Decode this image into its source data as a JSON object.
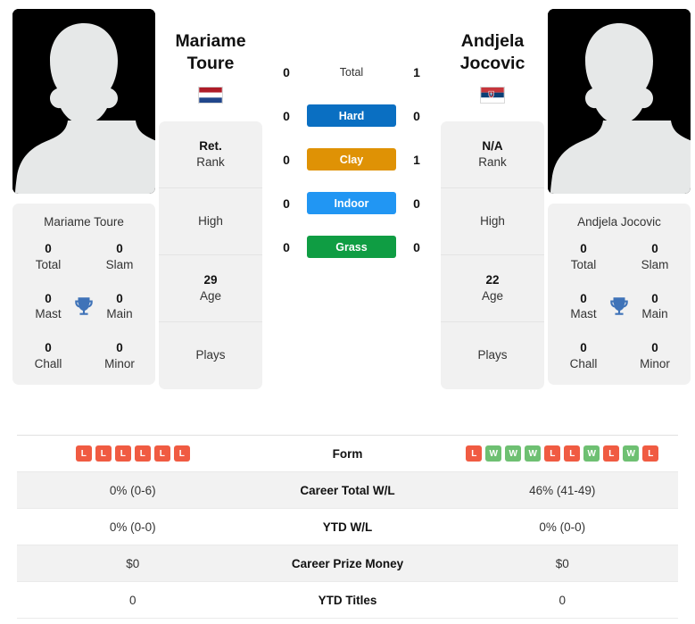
{
  "players": {
    "left": {
      "name_line1": "Mariame",
      "name_line2": "Toure",
      "full_name": "Mariame Toure",
      "flag": "netherlands-flag",
      "rank_value": "Ret.",
      "rank_label": "Rank",
      "high_label": "High",
      "age_value": "29",
      "age_label": "Age",
      "plays_label": "Plays",
      "titles": [
        {
          "num": "0",
          "label": "Total"
        },
        {
          "num": "0",
          "label": "Slam"
        },
        {
          "num": "0",
          "label": "Mast"
        },
        {
          "num": "0",
          "label": "Main"
        },
        {
          "num": "0",
          "label": "Chall"
        },
        {
          "num": "0",
          "label": "Minor"
        }
      ],
      "form": [
        "L",
        "L",
        "L",
        "L",
        "L",
        "L"
      ],
      "career_total_wl": "0% (0-6)",
      "ytd_wl": "0% (0-0)",
      "career_prize_money": "$0",
      "ytd_titles": "0"
    },
    "right": {
      "name_line1": "Andjela",
      "name_line2": "Jocovic",
      "full_name": "Andjela Jocovic",
      "flag": "serbia-flag",
      "rank_value": "N/A",
      "rank_label": "Rank",
      "high_label": "High",
      "age_value": "22",
      "age_label": "Age",
      "plays_label": "Plays",
      "titles": [
        {
          "num": "0",
          "label": "Total"
        },
        {
          "num": "0",
          "label": "Slam"
        },
        {
          "num": "0",
          "label": "Mast"
        },
        {
          "num": "0",
          "label": "Main"
        },
        {
          "num": "0",
          "label": "Chall"
        },
        {
          "num": "0",
          "label": "Minor"
        }
      ],
      "form": [
        "L",
        "W",
        "W",
        "W",
        "L",
        "L",
        "W",
        "L",
        "W",
        "L"
      ],
      "career_total_wl": "46% (41-49)",
      "ytd_wl": "0% (0-0)",
      "career_prize_money": "$0",
      "ytd_titles": "0"
    }
  },
  "h2h": [
    {
      "label": "Total",
      "left": "0",
      "right": "1",
      "color": "transparent",
      "plain": true
    },
    {
      "label": "Hard",
      "left": "0",
      "right": "0",
      "color": "#0a6fc2",
      "plain": false
    },
    {
      "label": "Clay",
      "left": "0",
      "right": "1",
      "color": "#df9205",
      "plain": false
    },
    {
      "label": "Indoor",
      "left": "0",
      "right": "0",
      "color": "#2196f3",
      "plain": false
    },
    {
      "label": "Grass",
      "left": "0",
      "right": "0",
      "color": "#0f9d43",
      "plain": false
    }
  ],
  "table": {
    "form_label": "Form",
    "rows": [
      {
        "label": "Career Total W/L",
        "left": "0% (0-6)",
        "right": "46% (41-49)"
      },
      {
        "label": "YTD W/L",
        "left": "0% (0-0)",
        "right": "0% (0-0)"
      },
      {
        "label": "Career Prize Money",
        "left": "$0",
        "right": "$0"
      },
      {
        "label": "YTD Titles",
        "left": "0",
        "right": "0"
      }
    ]
  },
  "colors": {
    "win": "#6ec072",
    "loss": "#f05b42",
    "trophy": "#3f73b8",
    "card_bg": "#f1f1f1",
    "row_alt": "#f2f2f2"
  }
}
